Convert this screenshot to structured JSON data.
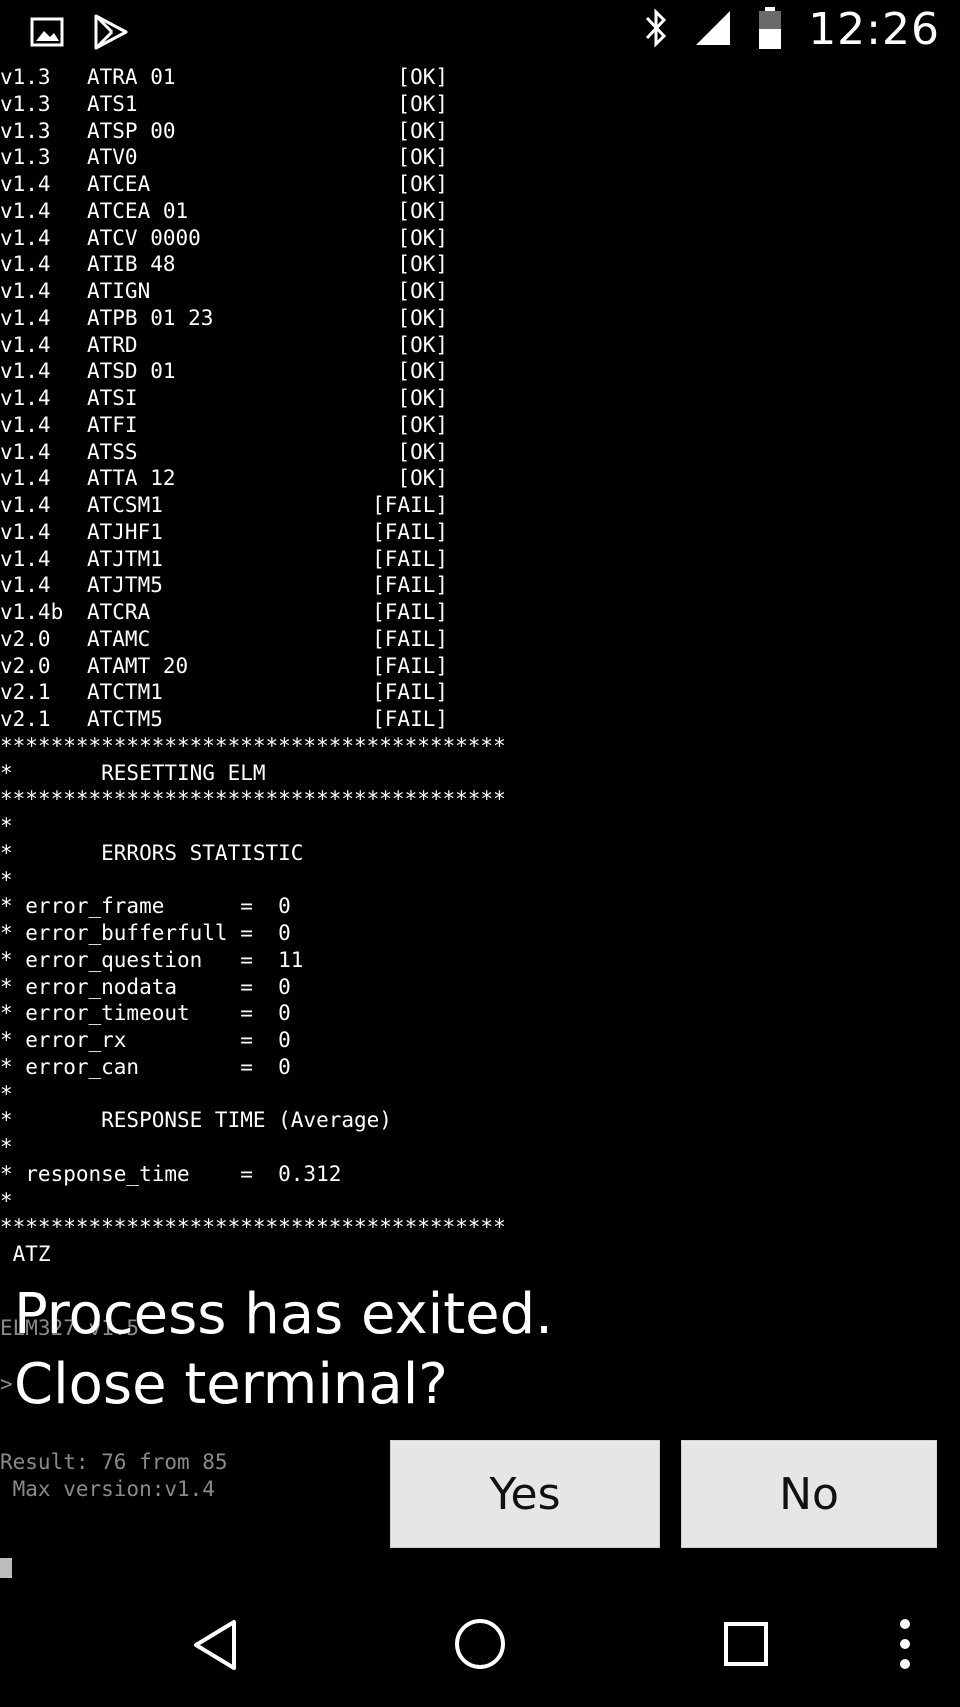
{
  "status_bar": {
    "time": "12:26",
    "left_icons": [
      "image-icon",
      "play-store-icon"
    ],
    "right_icons": [
      "bluetooth-icon",
      "cell-signal-icon",
      "battery-icon"
    ]
  },
  "terminal": {
    "commands": [
      {
        "version": "v1.3",
        "cmd": "ATRA 01",
        "result": "[OK]"
      },
      {
        "version": "v1.3",
        "cmd": "ATS1",
        "result": "[OK]"
      },
      {
        "version": "v1.3",
        "cmd": "ATSP 00",
        "result": "[OK]"
      },
      {
        "version": "v1.3",
        "cmd": "ATV0",
        "result": "[OK]"
      },
      {
        "version": "v1.4",
        "cmd": "ATCEA",
        "result": "[OK]"
      },
      {
        "version": "v1.4",
        "cmd": "ATCEA 01",
        "result": "[OK]"
      },
      {
        "version": "v1.4",
        "cmd": "ATCV 0000",
        "result": "[OK]"
      },
      {
        "version": "v1.4",
        "cmd": "ATIB 48",
        "result": "[OK]"
      },
      {
        "version": "v1.4",
        "cmd": "ATIGN",
        "result": "[OK]"
      },
      {
        "version": "v1.4",
        "cmd": "ATPB 01 23",
        "result": "[OK]"
      },
      {
        "version": "v1.4",
        "cmd": "ATRD",
        "result": "[OK]"
      },
      {
        "version": "v1.4",
        "cmd": "ATSD 01",
        "result": "[OK]"
      },
      {
        "version": "v1.4",
        "cmd": "ATSI",
        "result": "[OK]"
      },
      {
        "version": "v1.4",
        "cmd": "ATFI",
        "result": "[OK]"
      },
      {
        "version": "v1.4",
        "cmd": "ATSS",
        "result": "[OK]"
      },
      {
        "version": "v1.4",
        "cmd": "ATTA 12",
        "result": "[OK]"
      },
      {
        "version": "v1.4",
        "cmd": "ATCSM1",
        "result": "[FAIL]"
      },
      {
        "version": "v1.4",
        "cmd": "ATJHF1",
        "result": "[FAIL]"
      },
      {
        "version": "v1.4",
        "cmd": "ATJTM1",
        "result": "[FAIL]"
      },
      {
        "version": "v1.4",
        "cmd": "ATJTM5",
        "result": "[FAIL]"
      },
      {
        "version": "v1.4b",
        "cmd": "ATCRA",
        "result": "[FAIL]"
      },
      {
        "version": "v2.0",
        "cmd": "ATAMC",
        "result": "[FAIL]"
      },
      {
        "version": "v2.0",
        "cmd": "ATAMT 20",
        "result": "[FAIL]"
      },
      {
        "version": "v2.1",
        "cmd": "ATCTM1",
        "result": "[FAIL]"
      },
      {
        "version": "v2.1",
        "cmd": "ATCTM5",
        "result": "[FAIL]"
      }
    ],
    "log_lines": [
      "****************************************",
      "*       RESETTING ELM",
      "****************************************",
      "*",
      "*       ERRORS STATISTIC",
      "*",
      "* error_frame      =  0",
      "* error_bufferfull =  0",
      "* error_question   =  11",
      "* error_nodata     =  0",
      "* error_timeout    =  0",
      "* error_rx         =  0",
      "* error_can        =  0",
      "*",
      "*       RESPONSE TIME (Average)",
      "*",
      "* response_time    =  0.312",
      "*",
      "****************************************",
      " ATZ"
    ],
    "ghost_text_1": "ELM327 v1.5",
    "ghost_prompt": ">",
    "result_line": "Result: 76 from 85",
    "max_version_line": " Max version:v1.4"
  },
  "dialog": {
    "message_line1": "Process has exited.",
    "message_line2": "Close terminal?",
    "yes_label": "Yes",
    "no_label": "No"
  },
  "nav_bar": {
    "icons": [
      "back-icon",
      "home-icon",
      "recents-icon",
      "overflow-menu-icon"
    ]
  }
}
